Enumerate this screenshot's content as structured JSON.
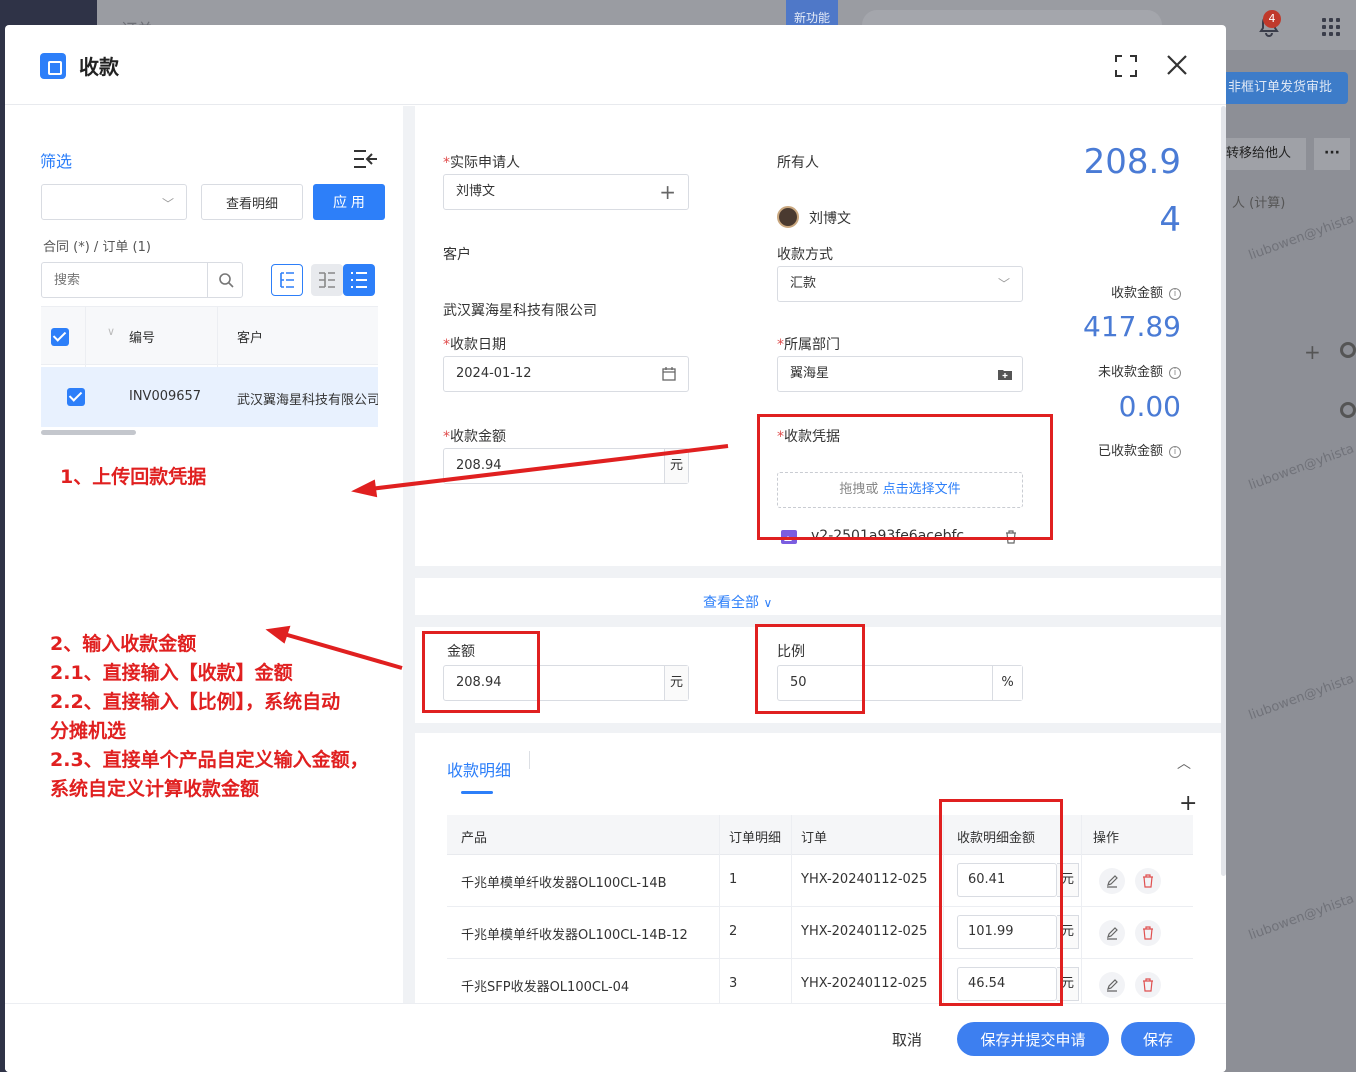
{
  "background": {
    "top_title": "订单",
    "new_feature": "新功能",
    "notification_count": "4",
    "approve_button": "非框订单发货审批",
    "transfer_button": "转移给他人",
    "more_button": "···",
    "calc_text": "人 (计算)",
    "watermark": "liubowen@yhista"
  },
  "modal": {
    "title": "收款",
    "icons": [
      "fullscreen-icon",
      "close-icon"
    ]
  },
  "filter_panel": {
    "title": "筛选",
    "detail_button": "查看明细",
    "apply_button": "应 用",
    "tabs_line": "合同 (*)  / 订单 (1)",
    "search_placeholder": "搜索",
    "grid": {
      "headers": [
        "编号",
        "客户"
      ],
      "rows": [
        {
          "id": "INV009657",
          "customer": "武汉翼海星科技有限公司"
        }
      ]
    }
  },
  "form": {
    "applicant": {
      "label": "实际申请人",
      "value": "刘博文"
    },
    "owner": {
      "label": "所有人",
      "value": "刘博文"
    },
    "customer": {
      "label": "客户",
      "value": "武汉翼海星科技有限公司"
    },
    "payment_method": {
      "label": "收款方式",
      "value": "汇款"
    },
    "date": {
      "label": "收款日期",
      "value": "2024-01-12"
    },
    "department": {
      "label": "所属部门",
      "value": "翼海星"
    },
    "amount": {
      "label": "收款金额",
      "value": "208.94",
      "unit": "元"
    },
    "voucher": {
      "label": "收款凭据",
      "upload_hint": "拖拽或 ",
      "upload_link": "点击选择文件",
      "file_name": "v2-2501a93fe6acebfc..."
    },
    "view_all": "查看全部"
  },
  "summary": {
    "received_amount_line1": "208.9",
    "received_amount_line2": "4",
    "received_label": "收款金额",
    "unreceived_value": "417.89",
    "unreceived_label": "未收款金额",
    "collected_value": "0.00",
    "collected_label": "已收款金额"
  },
  "allocation": {
    "amount_label": "金额",
    "amount_value": "208.94",
    "amount_unit": "元",
    "ratio_label": "比例",
    "ratio_value": "50",
    "ratio_unit": "%"
  },
  "details": {
    "tab_label": "收款明细",
    "headers": [
      "产品",
      "订单明细",
      "订单",
      "收款明细金额",
      "操作"
    ],
    "unit": "元",
    "rows": [
      {
        "product": "千兆单模单纤收发器OL100CL-14B",
        "line": "1",
        "order": "YHX-20240112-025",
        "amount": "60.41"
      },
      {
        "product": "千兆单模单纤收发器OL100CL-14B-12",
        "line": "2",
        "order": "YHX-20240112-025",
        "amount": "101.99"
      },
      {
        "product": "千兆SFP收发器OL100CL-04",
        "line": "3",
        "order": "YHX-20240112-025",
        "amount": "46.54"
      }
    ]
  },
  "footer": {
    "cancel": "取消",
    "submit": "保存并提交申请",
    "save": "保存"
  },
  "annotations": {
    "note1": "1、上传回款凭据",
    "note2_lines": [
      "2、输入收款金额",
      "2.1、直接输入【收款】金额",
      "2.2、直接输入【比例】，系统自动",
      "分摊机选",
      "2.3、直接单个产品自定义输入金额，",
      "系统自定义计算收款金额"
    ],
    "color": "#e02020"
  }
}
